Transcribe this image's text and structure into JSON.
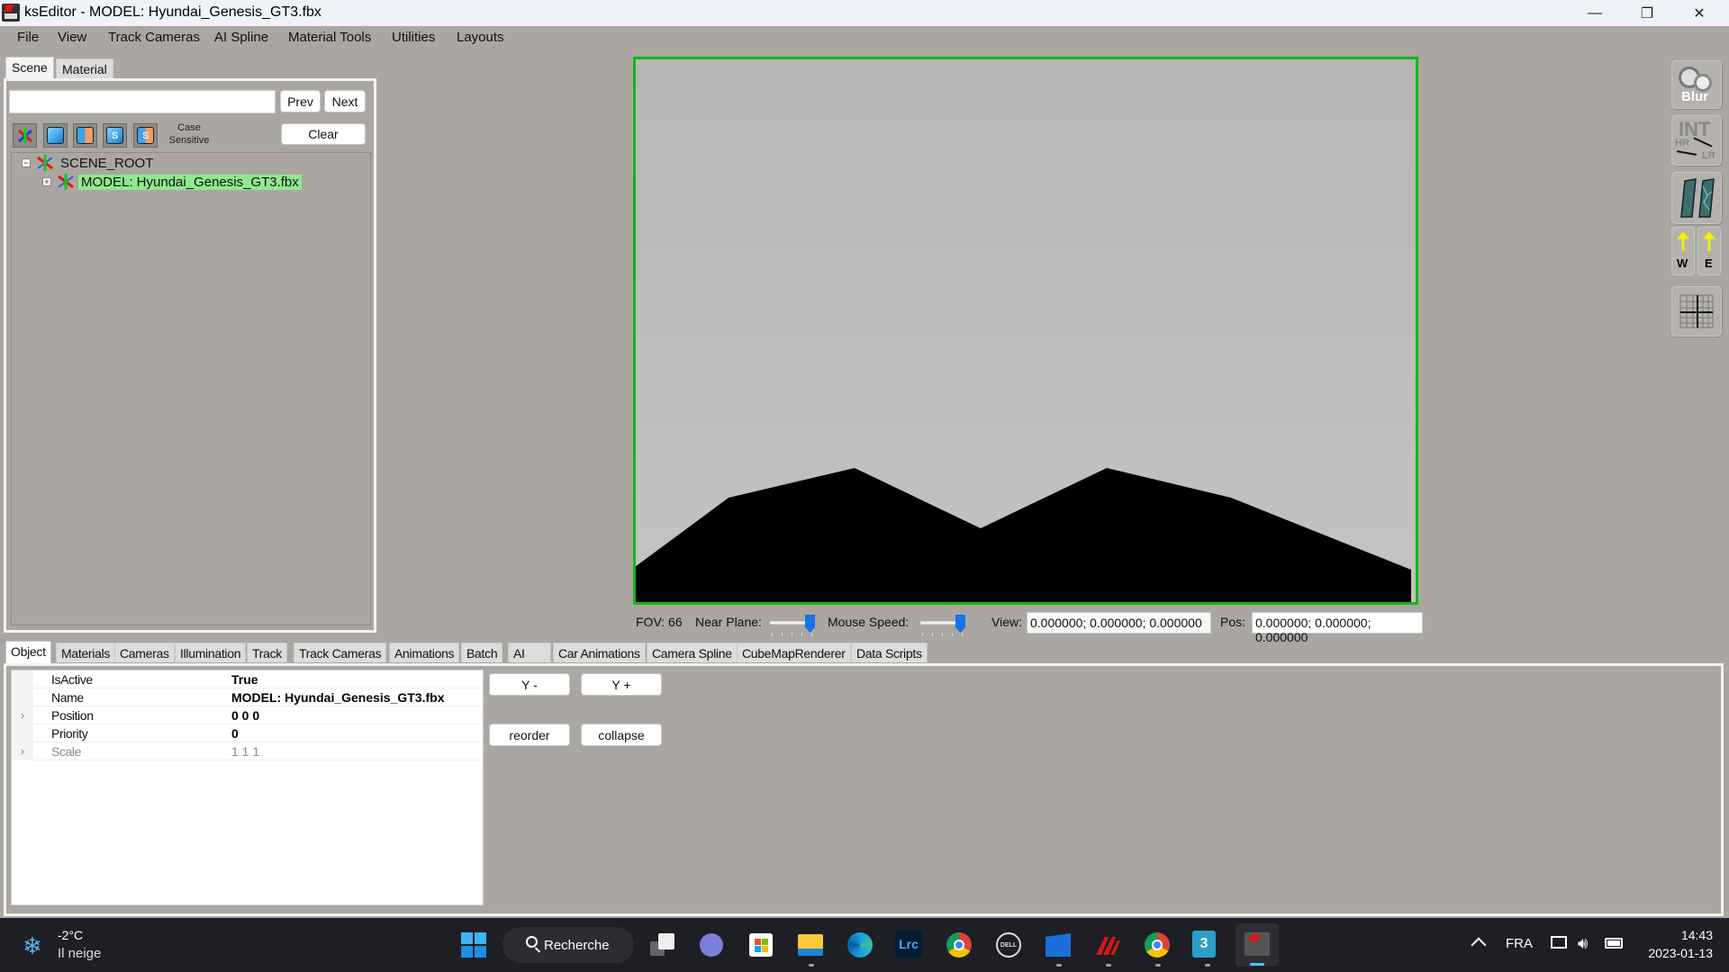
{
  "window": {
    "title": "ksEditor - MODEL: Hyundai_Genesis_GT3.fbx",
    "controls": {
      "minimize": "—",
      "maximize": "❐",
      "close": "✕"
    }
  },
  "menu": [
    "File",
    "View",
    "Track Cameras",
    "AI Spline",
    "Material Tools",
    "Utilities",
    "Layouts"
  ],
  "scene_panel": {
    "tabs": [
      {
        "label": "Scene",
        "active": true
      },
      {
        "label": "Material",
        "active": false
      }
    ],
    "search": {
      "value": "",
      "placeholder": ""
    },
    "prev_label": "Prev",
    "next_label": "Next",
    "clear_label": "Clear",
    "case_sensitive_label": "Case Sensitive",
    "tool_icons": [
      "axis-filter-icon",
      "cube-filter-icon",
      "cube-half-filter-icon",
      "shader-cube-filter-icon",
      "shader-cube-half-filter-icon"
    ],
    "tree": [
      {
        "label": "SCENE_ROOT",
        "expander": "−",
        "level": 0,
        "selected": false
      },
      {
        "label": "MODEL: Hyundai_Genesis_GT3.fbx",
        "expander": "+",
        "level": 1,
        "selected": true
      }
    ]
  },
  "viewport": {
    "border_color": "#17b417",
    "fov_label": "FOV: 66",
    "near_plane_label": "Near Plane:",
    "near_plane_value": 1.0,
    "mouse_speed_label": "Mouse Speed:",
    "mouse_speed_value": 1.0,
    "view_label": "View:",
    "view_value": "0.000000; 0.000000; 0.000000",
    "pos_label": "Pos:",
    "pos_value": "0.000000; 0.000000; 0.000000"
  },
  "side_tools": [
    {
      "name": "blur-icon",
      "label": "Blur"
    },
    {
      "name": "int-hr-lr-icon",
      "label": "INT",
      "sub1": "HR",
      "sub2": "LR"
    },
    {
      "name": "glass-damage-icon",
      "label": ""
    },
    {
      "name": "wind-direction-icon",
      "w": "W",
      "e": "E"
    },
    {
      "name": "grid-icon",
      "label": ""
    }
  ],
  "bottom_tabs": [
    {
      "label": "Object",
      "active": true
    },
    {
      "label": "Materials"
    },
    {
      "label": "Cameras"
    },
    {
      "label": "Illumination"
    },
    {
      "label": "Track"
    },
    {
      "label": "Track Cameras"
    },
    {
      "label": "Animations"
    },
    {
      "label": "Batch"
    },
    {
      "label": "AI"
    },
    {
      "label": "Car Animations"
    },
    {
      "label": "Camera Spline"
    },
    {
      "label": "CubeMapRenderer"
    },
    {
      "label": "Data Scripts"
    }
  ],
  "properties": [
    {
      "name": "IsActive",
      "value": "True",
      "expandable": false,
      "dim": false
    },
    {
      "name": "Name",
      "value": "MODEL: Hyundai_Genesis_GT3.fbx",
      "expandable": false,
      "dim": false
    },
    {
      "name": "Position",
      "value": "0 0 0",
      "expandable": true,
      "dim": false
    },
    {
      "name": "Priority",
      "value": "0",
      "expandable": false,
      "dim": false
    },
    {
      "name": "Scale",
      "value": "1 1 1",
      "expandable": true,
      "dim": true
    }
  ],
  "object_buttons": {
    "y_minus": "Y -",
    "y_plus": "Y +",
    "reorder": "reorder",
    "collapse": "collapse"
  },
  "taskbar": {
    "weather_temp": "-2°C",
    "weather_desc": "Il neige",
    "search_label": "Recherche",
    "apps": [
      "start",
      "task-view",
      "teams-chat",
      "microsoft-store",
      "file-explorer",
      "edge",
      "lightroom-classic",
      "chrome",
      "dell",
      "video-editor",
      "assetto-corsa",
      "chrome-profile",
      "3ds-max",
      "ks-editor"
    ],
    "lrc_label": "Lrc",
    "max_label": "3",
    "dell_label": "DELL",
    "language": "FRA",
    "time": "14:43",
    "date": "2023-01-13"
  }
}
